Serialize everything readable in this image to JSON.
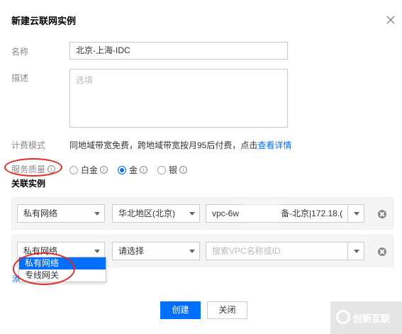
{
  "dialog": {
    "title": "新建云联网实例",
    "close_label": "×"
  },
  "form": {
    "name_label": "名称",
    "name_value": "北京-上海-IDC",
    "desc_label": "描述",
    "desc_placeholder": "选填",
    "billing_label": "计费模式",
    "billing_text": "同地域带宽免费，跨地域带宽按月95后付费，点击",
    "billing_link": "查看详情",
    "qos_label": "服务质量",
    "qos_info": "i",
    "qos_options": [
      {
        "label": "白金",
        "checked": false
      },
      {
        "label": "金",
        "checked": true
      },
      {
        "label": "银",
        "checked": false
      }
    ]
  },
  "instances": {
    "section_title": "关联实例",
    "rows": [
      {
        "type": "私有网络",
        "region": "华北地区(北京)",
        "vpc": "vpc-6w",
        "vpc_suffix": "备-北京|172.18.("
      },
      {
        "type": "私有网络",
        "region": "请选择",
        "vpc_placeholder": "搜索VPC名称或ID"
      }
    ],
    "dropdown_options": [
      {
        "label": "私有网络",
        "active": true
      },
      {
        "label": "专线网关",
        "active": false
      }
    ],
    "link_fragment": "添"
  },
  "actions": {
    "create_label": "创建",
    "close_label": "关闭"
  },
  "watermark": {
    "text": "创新互联"
  },
  "colors": {
    "accent": "#006eff",
    "annotation": "#e02a2a"
  }
}
